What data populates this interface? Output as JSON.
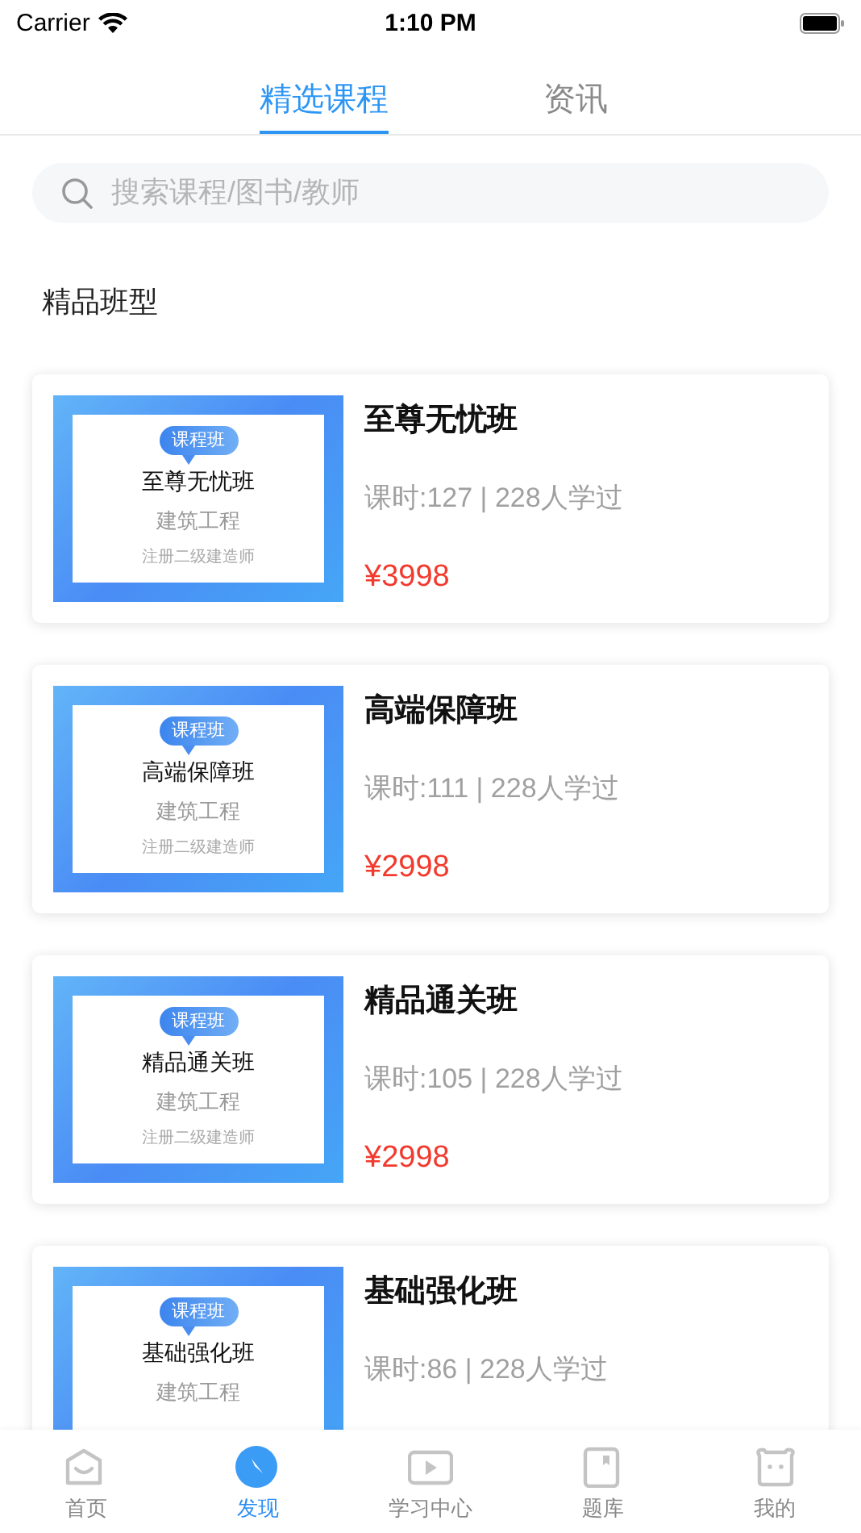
{
  "status_bar": {
    "carrier": "Carrier",
    "time": "1:10 PM"
  },
  "tabs": [
    {
      "label": "精选课程",
      "selected": true
    },
    {
      "label": "资讯",
      "selected": false
    }
  ],
  "search": {
    "placeholder": "搜索课程/图书/教师"
  },
  "section_title": "精品班型",
  "courses": [
    {
      "thumbnail": {
        "badge": "课程班",
        "title": "至尊无忧班",
        "subject": "建筑工程",
        "cert": "注册二级建造师"
      },
      "name": "至尊无忧班",
      "meta": "课时:127 | 228人学过",
      "price": "¥3998"
    },
    {
      "thumbnail": {
        "badge": "课程班",
        "title": "高端保障班",
        "subject": "建筑工程",
        "cert": "注册二级建造师"
      },
      "name": "高端保障班",
      "meta": "课时:111 | 228人学过",
      "price": "¥2998"
    },
    {
      "thumbnail": {
        "badge": "课程班",
        "title": "精品通关班",
        "subject": "建筑工程",
        "cert": "注册二级建造师"
      },
      "name": "精品通关班",
      "meta": "课时:105 | 228人学过",
      "price": "¥2998"
    },
    {
      "thumbnail": {
        "badge": "课程班",
        "title": "基础强化班",
        "subject": "建筑工程"
      },
      "name": "基础强化班",
      "meta": "课时:86 | 228人学过"
    }
  ],
  "tab_bar": [
    {
      "label": "首页",
      "kind": "home",
      "selected": false
    },
    {
      "label": "发现",
      "kind": "discover",
      "selected": true
    },
    {
      "label": "学习中心",
      "kind": "play",
      "selected": false
    },
    {
      "label": "题库",
      "kind": "book",
      "selected": false
    },
    {
      "label": "我的",
      "kind": "face",
      "selected": false
    }
  ]
}
